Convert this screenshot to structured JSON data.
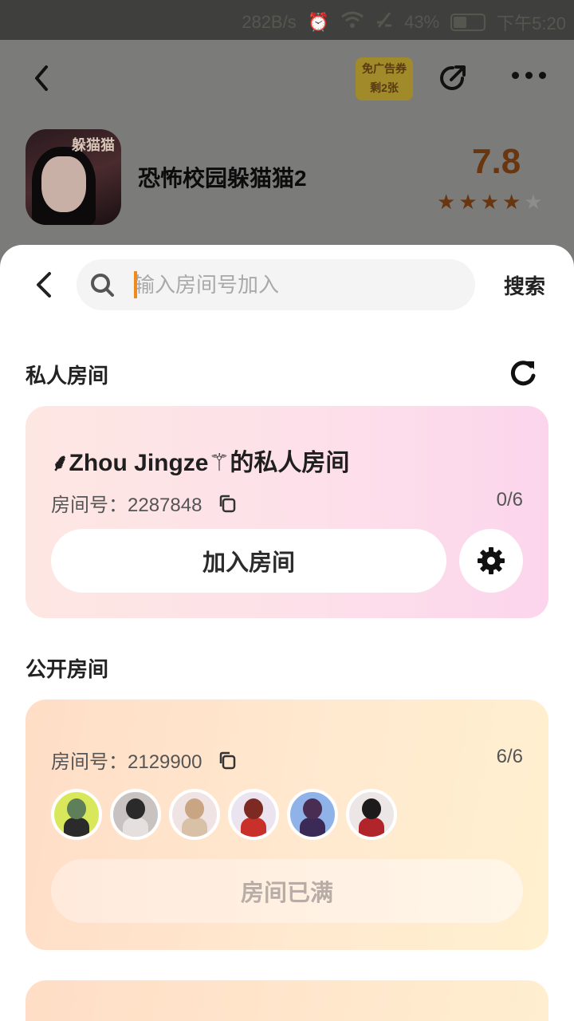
{
  "status_bar": {
    "speed": "282B/s",
    "battery": "43%",
    "battery_level": 0.43,
    "time": "下午5:20"
  },
  "app_header": {
    "coupon_line1": "免广告券",
    "coupon_line2": "剩2张",
    "game_icon_text": "躲猫猫",
    "game_title": "恐怖校园躲猫猫2",
    "score": "7.8",
    "stars_filled": 4,
    "stars_total": 5
  },
  "search": {
    "placeholder": "输入房间号加入",
    "button_label": "搜索"
  },
  "private_section": {
    "title": "私人房间",
    "room": {
      "name": "⸙Zhou Jingze⚚的私人房间",
      "id_label": "房间号：2287848",
      "count": "0/6",
      "join_label": "加入房间"
    }
  },
  "public_section": {
    "title": "公开房间",
    "rooms": [
      {
        "id_label": "房间号：2129900",
        "count": "6/6",
        "full_label": "房间已满",
        "avatars": [
          {
            "bg": "#d9e85a",
            "head": "#5f7f5a",
            "body": "#2b2b2b"
          },
          {
            "bg": "#c8c2c0",
            "head": "#2a2a2a",
            "body": "#e5e0dd"
          },
          {
            "bg": "#efe3e3",
            "head": "#caa583",
            "body": "#d9c1a8"
          },
          {
            "bg": "#ece3f0",
            "head": "#7c2a22",
            "body": "#c9302a"
          },
          {
            "bg": "#8fb3e8",
            "head": "#4a2d52",
            "body": "#3b2a56"
          },
          {
            "bg": "#ece6e6",
            "head": "#1c1a1b",
            "body": "#b1252a"
          }
        ]
      }
    ]
  }
}
